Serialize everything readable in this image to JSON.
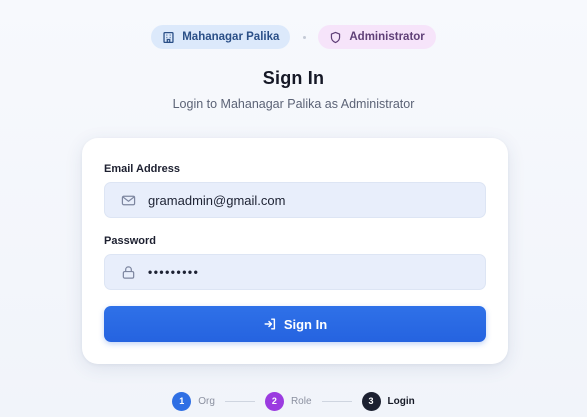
{
  "badges": {
    "org": {
      "label": "Mahanagar Palika",
      "icon": "building-icon"
    },
    "role": {
      "label": "Administrator",
      "icon": "shield-icon"
    }
  },
  "header": {
    "title": "Sign In",
    "subtitle": "Login to Mahanagar Palika as Administrator"
  },
  "form": {
    "email": {
      "label": "Email Address",
      "value": "gramadmin@gmail.com",
      "icon": "mail-icon"
    },
    "password": {
      "label": "Password",
      "value": "•••••••••",
      "icon": "lock-icon"
    },
    "submit": {
      "label": "Sign In",
      "icon": "login-icon"
    }
  },
  "stepper": {
    "steps": [
      {
        "number": "1",
        "label": "Org"
      },
      {
        "number": "2",
        "label": "Role"
      },
      {
        "number": "3",
        "label": "Login"
      }
    ]
  },
  "colors": {
    "primary": "#2563e0",
    "role_accent": "#9b3be0",
    "org_badge_bg": "#dce9fb",
    "role_badge_bg": "#f6e4fa",
    "input_bg": "#e8eefb",
    "active_step": "#1c2030"
  }
}
